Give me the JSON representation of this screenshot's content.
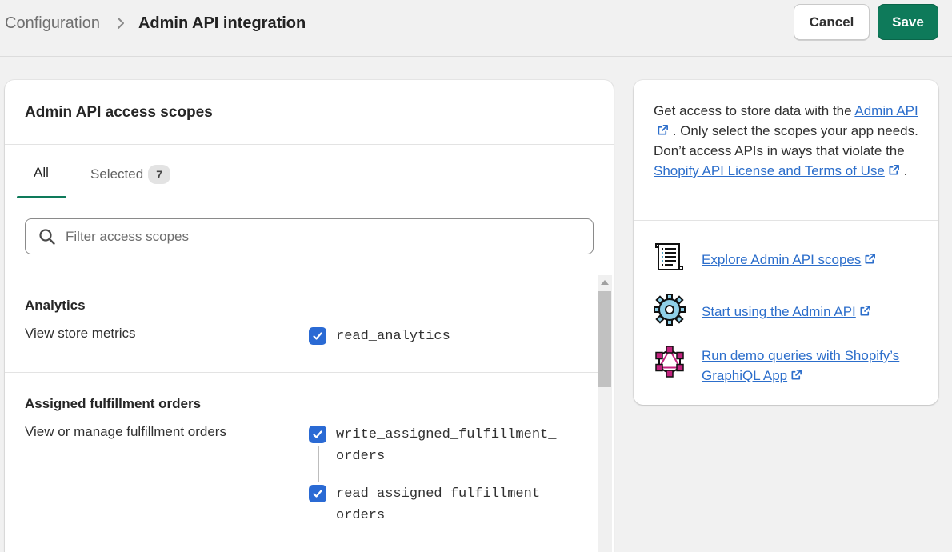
{
  "header": {
    "breadcrumb_parent": "Configuration",
    "breadcrumb_current": "Admin API integration",
    "cancel_label": "Cancel",
    "save_label": "Save"
  },
  "scopes_card": {
    "title": "Admin API access scopes",
    "tabs": [
      {
        "label": "All",
        "active": true
      },
      {
        "label": "Selected",
        "count": "7",
        "active": false
      }
    ],
    "search": {
      "placeholder": "Filter access scopes",
      "value": ""
    },
    "sections": [
      {
        "title": "Analytics",
        "description": "View store metrics",
        "scopes": [
          {
            "label": "read_analytics",
            "checked": true
          }
        ]
      },
      {
        "title": "Assigned fulfillment orders",
        "description": "View or manage fulfillment orders",
        "scopes": [
          {
            "label_line1": "write_assigned_fulfillment_",
            "label_line2": "orders",
            "checked": true
          },
          {
            "label_line1": "read_assigned_fulfillment_",
            "label_line2": "orders",
            "checked": true
          }
        ]
      }
    ]
  },
  "info_card": {
    "intro_part1": "Get access to store data with the ",
    "intro_link1": "Admin API",
    "intro_part2": ". Only select the scopes your app needs. Don’t access APIs in ways that violate the ",
    "intro_link2": "Shopify API License and Terms of Use",
    "intro_part3": ".",
    "resources": [
      {
        "icon": "scroll-document-icon",
        "label": "Explore Admin API scopes"
      },
      {
        "icon": "gear-icon",
        "label": "Start using the Admin API"
      },
      {
        "icon": "graphql-icon",
        "label": "Run demo queries with Shopify’s GraphiQL App"
      }
    ]
  },
  "colors": {
    "accent_green": "#0e7a5a",
    "checkbox_blue": "#2a6ad4",
    "link_blue": "#2c6ecb"
  }
}
